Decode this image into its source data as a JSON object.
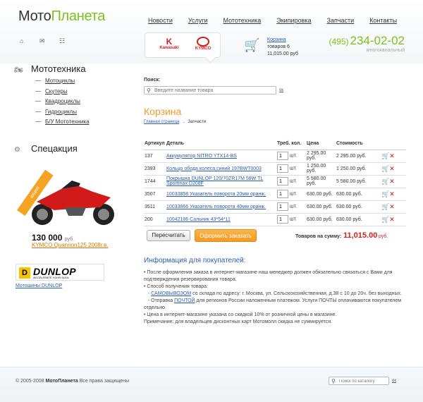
{
  "logo": {
    "part1": "Мото",
    "part2": "Планета"
  },
  "nav": [
    "Новости",
    "Услуги",
    "Мототехника",
    "Экипировка",
    "Запчасти",
    "Контакты"
  ],
  "header_icons": [
    "home-icon",
    "mail-icon",
    "sitemap-icon"
  ],
  "brands": {
    "kawasaki": "Kawasaki",
    "kymco": "KYMCO"
  },
  "cart": {
    "link": "Корзина",
    "count": "товаров 6",
    "sum": "11,015.00 руб"
  },
  "phone": {
    "code": "(495)",
    "number": "234-02-02",
    "sub": "многоканальный"
  },
  "sidebar": {
    "moto_heading": "Мототехника",
    "moto_items": [
      "Мотоциклы",
      "Скутеры",
      "Квадроциклы",
      "Гидроциклы",
      "Б/У Мототехника"
    ],
    "special_heading": "Спецакция",
    "promo_ribbon": "акция",
    "promo_price": "130 000",
    "promo_currency": "руб.",
    "promo_link": "KYMCO Quannon125 2008г.в.",
    "dunlop_name": "DUNLOP",
    "dunlop_slogan": "ACCELERATE YOUR SOUL",
    "dunlop_link": "Мотошины DUNLOP"
  },
  "search": {
    "label": "Поиск:",
    "placeholder": "Введите название товара",
    "ok": "ок"
  },
  "page_title": "Корзина",
  "breadcrumb": {
    "home": "Главная страница",
    "current": "Запчасти"
  },
  "table": {
    "headers": [
      "Артикул",
      "Деталь",
      "Треб. кол.",
      "Цена",
      "Стоимость"
    ],
    "unit": "шт.",
    "rows": [
      {
        "art": "137",
        "name": "Аккумулятор NITRO YTX14-BS",
        "qty": "1",
        "price": "2 295.00 руб.",
        "cost": "2 295.00 руб."
      },
      {
        "art": "2393",
        "name": "Кольцо обода колеса,синий 197BWT0003",
        "qty": "1",
        "price": "1 250.00 руб.",
        "cost": "1 250.00 руб."
      },
      {
        "art": "1744",
        "name": "Покрышка DUNLOP 120/70ZR17M 58W TL Sportmax D208F",
        "qty": "1",
        "price": "5 580.00 руб.",
        "cost": "5 580.00 руб."
      },
      {
        "art": "3507",
        "name": "10033858 Указатель поворота 20мм оранж.",
        "qty": "1",
        "price": "630.00 руб.",
        "cost": "630.00 руб."
      },
      {
        "art": "3511",
        "name": "10033866 Указатель поворота 40мм оранж.",
        "qty": "1",
        "price": "630.00 руб.",
        "cost": "630.00 руб."
      },
      {
        "art": "200",
        "name": "10042186 Сальник 43*54*11",
        "qty": "1",
        "price": "630.00 руб.",
        "cost": "630.00 руб."
      }
    ]
  },
  "buttons": {
    "recalc": "Пересчитать",
    "order": "Оформить заказать"
  },
  "total": {
    "label": "Товаров на сумму:",
    "value": "11,015.00",
    "currency": "руб."
  },
  "info": {
    "title": "Информация для покупателей:",
    "p1": "•  После оформления заказа в интернет-магазине наш менеджер должен обязательно связаться с Вами для подтверждения резервирования товара.",
    "p2": "•  Способ получения товара:",
    "p3a": "САМОВЫВОЗОМ",
    "p3b": " со склада по адресу: г. Москва, ул. Сельскохозяйственная, д.38 с 10 до 20ч. без выходных.",
    "p4a": "- Отправка ",
    "p4b": "ПОЧТОЙ",
    "p4c": " для регионов России наложенным платежом. Услуги ПОЧТЫ оплачиваются покупателем отдельно.",
    "p5": "•  Цена в интернет-магазине указана со скидкой 10% от розничной цены в магазине.",
    "p6": "Примечание: для владельцев дисконтных карт Мотомолл скидка не суммируется."
  },
  "footer": {
    "copyright_pre": "©   2005-2008 ",
    "copyright_brand": "МотоПланета",
    "copyright_post": " Все права защищены",
    "search_placeholder": "Поиск по каталогу",
    "ok": "ок"
  }
}
